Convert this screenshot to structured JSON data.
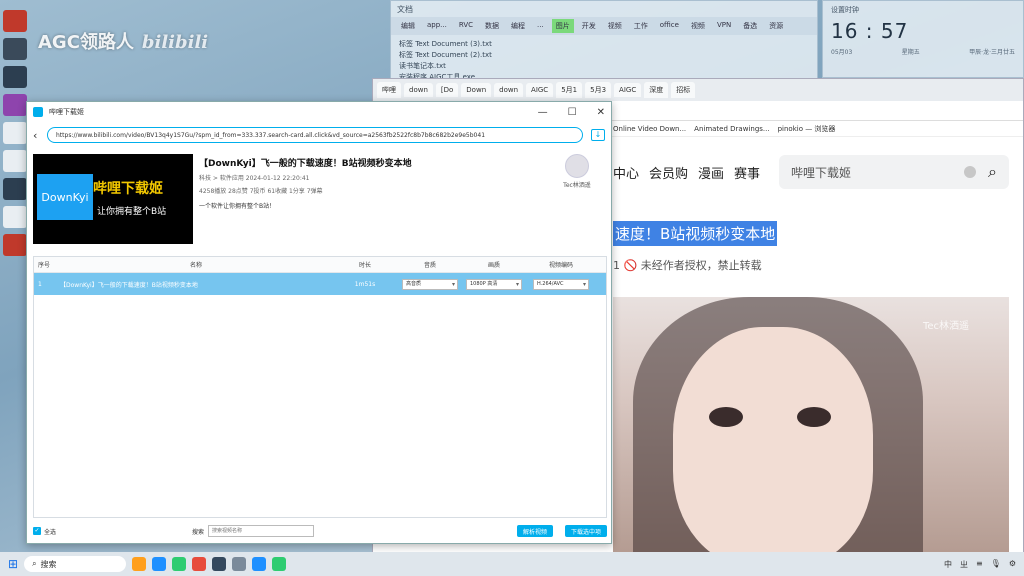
{
  "desktop": {
    "watermark": "AGC领路人",
    "watermark_brand": "bilibili"
  },
  "note_window": {
    "title": "文档",
    "tabs": [
      "编辑",
      "app...",
      "RVC",
      "数据",
      "编程",
      "...",
      "图片",
      "开发",
      "视频",
      "工作",
      "office",
      "视频",
      "VPN",
      "备选",
      "资源"
    ],
    "active_tab_index": 6,
    "lines": [
      "标签 Text Document (3).txt",
      "标签 Text Document (2).txt",
      "读书笔记本.txt",
      "安装程序 AIGC工具.exe"
    ]
  },
  "clock": {
    "label": "设置时钟",
    "time": "16 : 57",
    "date": "05月03",
    "weekday": "星期五",
    "lunar": "甲辰·龙·三月廿五"
  },
  "browser": {
    "tabs": [
      "哔哩",
      "down",
      "[Do",
      "Down",
      "down",
      "AIGC",
      "5月1",
      "5月3",
      "AIGC",
      "深度",
      "招标"
    ],
    "bookmarks": [
      "Online Video Down...",
      "Animated Drawings...",
      "pinokio — 浏览器"
    ],
    "nav": [
      "中心",
      "会员购",
      "漫画",
      "赛事"
    ],
    "search_placeholder": "哔哩下载姬",
    "video_title": "速度！B站视频秒变本地",
    "video_meta": "1  🚫 未经作者授权，禁止转载",
    "frame_watermark": "Tec林洒遥"
  },
  "app": {
    "title": "哔哩下载姬",
    "url": "https://www.bilibili.com/video/BV13q4y1S7Gu/?spm_id_from=333.337.search-card.all.click&vd_source=a2563fb2522fc8b7b8c682b2e9e5b041",
    "cover": {
      "logo_text": "DownKyi",
      "name": "哔哩下载姬",
      "slogan": "让你拥有整个B站"
    },
    "video": {
      "title": "【DownKyi】飞一般的下载速度！B站视频秒变本地",
      "subline": "科技 > 软件应用    2024-01-12 22:20:41",
      "stats": "4258播放  28点赞  7投币  61收藏  1分享  7弹幕",
      "desc": "一个软件让你拥有整个B站！"
    },
    "uploader": "Tec林洒遥",
    "table": {
      "headers": [
        "序号",
        "名称",
        "时长",
        "音质",
        "画质",
        "视频编码"
      ],
      "rows": [
        {
          "index": "1",
          "name": "【DownKyi】飞一般的下载速度！B站视频秒变本地",
          "duration": "1m51s",
          "audio": "高音质",
          "quality": "1080P 高清",
          "codec": "H.264/AVC"
        }
      ]
    },
    "select_all": "全选",
    "search_label": "搜索",
    "search_placeholder": "搜索视频名称",
    "parse_button": "解析视频",
    "download_button": "下载选中项"
  },
  "taskbar": {
    "search_label": "搜索",
    "tray": [
      "中",
      "ㄓ",
      "≡",
      "🎙",
      "⚙"
    ]
  }
}
